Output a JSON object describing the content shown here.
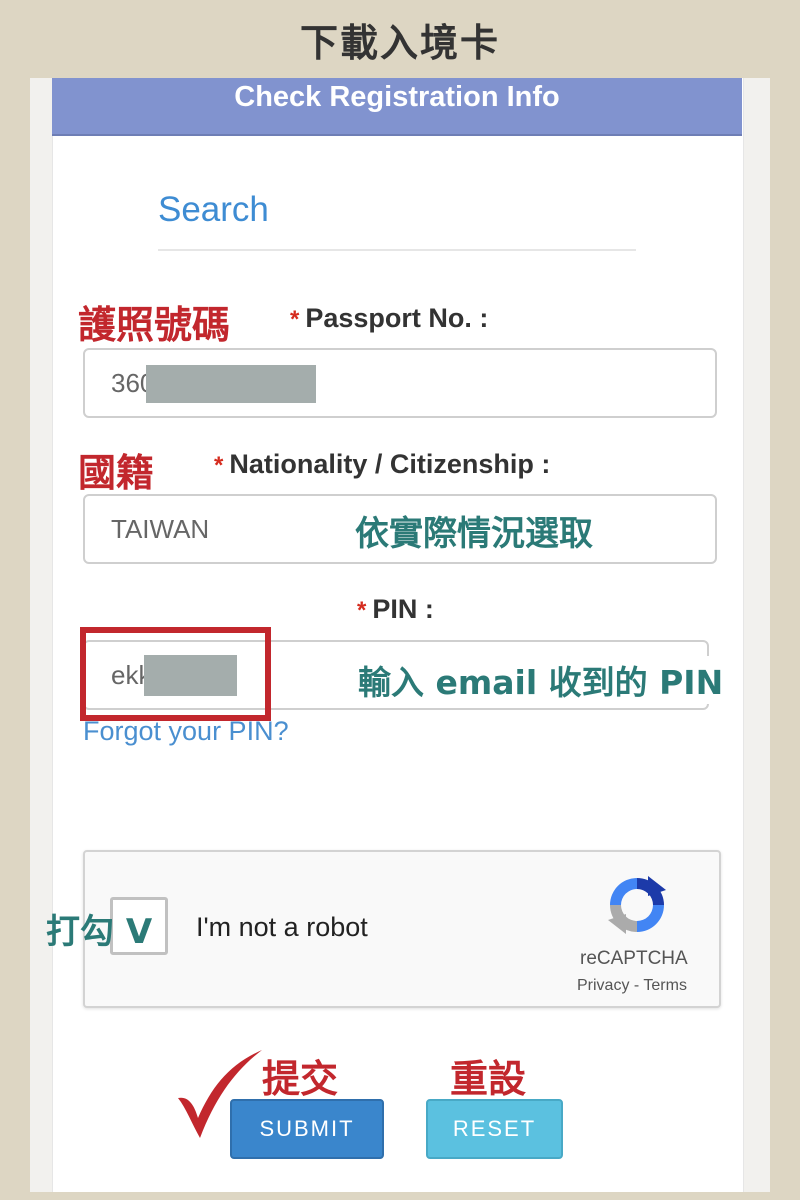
{
  "banner": {
    "title": "下載入境卡"
  },
  "form": {
    "header": "Check Registration Info",
    "search_title": "Search",
    "passport": {
      "label": "Passport No. :",
      "value": "360"
    },
    "nationality": {
      "label": "Nationality / Citizenship :",
      "value": "TAIWAN"
    },
    "pin": {
      "label": "PIN :",
      "value": "ekk"
    },
    "required_marker": "*",
    "forgot_link": "Forgot your PIN?",
    "recaptcha": {
      "prompt": "I'm not a robot",
      "brand": "reCAPTCHA",
      "privacy": "Privacy",
      "separator": "-",
      "terms": "Terms"
    },
    "buttons": {
      "submit": "SUBMIT",
      "reset": "RESET"
    }
  },
  "annotations": {
    "passport": "護照號碼",
    "nationality": "國籍",
    "nationality_hint": "依實際情況選取",
    "pin_hint": "輸入 email 收到的 PIN",
    "captcha_hint": "打勾 V",
    "submit_hint": "提交",
    "reset_hint": "重設"
  },
  "colors": {
    "header": "#8193cf",
    "annotation_red": "#c2272d",
    "annotation_green": "#2b7a77",
    "link": "#4a8fd0",
    "submit": "#3a86cc",
    "reset": "#5bc1e0"
  },
  "icons": {
    "recaptcha": "recaptcha-logo-icon",
    "check": "checkmark-icon"
  }
}
